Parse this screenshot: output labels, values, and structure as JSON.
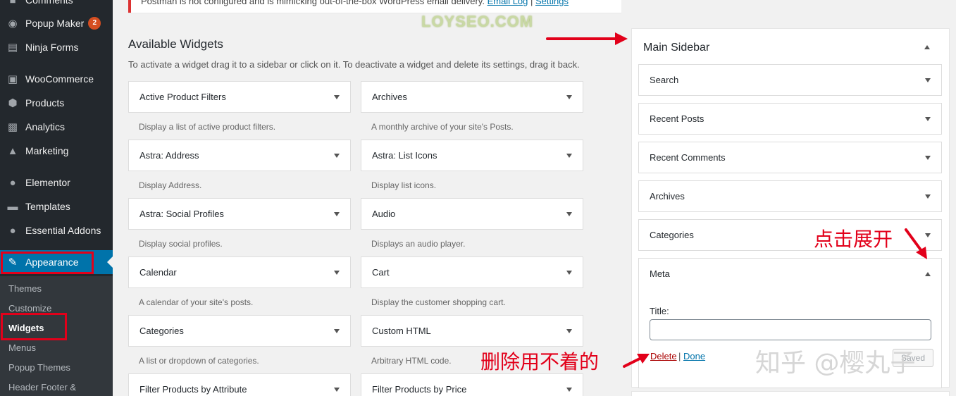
{
  "notice": {
    "text": "Postman is not configured and is mimicking out-of-the-box WordPress email delivery.",
    "link_log": "Email Log",
    "link_settings": "Settings"
  },
  "watermark_top": "LOYSEO.COM",
  "menu": {
    "comments": "Comments",
    "popup_maker": "Popup Maker",
    "popup_maker_badge": "2",
    "ninja_forms": "Ninja Forms",
    "woocommerce": "WooCommerce",
    "products": "Products",
    "analytics": "Analytics",
    "marketing": "Marketing",
    "elementor": "Elementor",
    "templates": "Templates",
    "essential_addons": "Essential Addons",
    "appearance": "Appearance"
  },
  "submenu": {
    "themes": "Themes",
    "customize": "Customize",
    "widgets": "Widgets",
    "menus": "Menus",
    "popup_themes": "Popup Themes",
    "header_footer": "Header Footer &"
  },
  "available": {
    "title": "Available Widgets",
    "description": "To activate a widget drag it to a sidebar or click on it. To deactivate a widget and delete its settings, drag it back.",
    "widgets": [
      {
        "title": "Active Product Filters",
        "desc": "Display a list of active product filters."
      },
      {
        "title": "Archives",
        "desc": "A monthly archive of your site's Posts."
      },
      {
        "title": "Astra: Address",
        "desc": "Display Address."
      },
      {
        "title": "Astra: List Icons",
        "desc": "Display list icons."
      },
      {
        "title": "Astra: Social Profiles",
        "desc": "Display social profiles."
      },
      {
        "title": "Audio",
        "desc": "Displays an audio player."
      },
      {
        "title": "Calendar",
        "desc": "A calendar of your site's posts."
      },
      {
        "title": "Cart",
        "desc": "Display the customer shopping cart."
      },
      {
        "title": "Categories",
        "desc": "A list or dropdown of categories."
      },
      {
        "title": "Custom HTML",
        "desc": "Arbitrary HTML code."
      },
      {
        "title": "Filter Products by Attribute",
        "desc": ""
      },
      {
        "title": "Filter Products by Price",
        "desc": ""
      }
    ]
  },
  "sidebar": {
    "title": "Main Sidebar",
    "widgets": [
      "Search",
      "Recent Posts",
      "Recent Comments",
      "Archives",
      "Categories",
      "Meta"
    ],
    "meta_form": {
      "title_label": "Title:",
      "title_value": "",
      "delete_label": "Delete",
      "separator": "|",
      "done_label": "Done",
      "save_label": "Saved"
    }
  },
  "annotations": {
    "expand": "点击展开",
    "delete_unused": "删除用不着的",
    "watermark": "知乎 @樱丸子"
  },
  "colors": {
    "menu_bg": "#23282d",
    "submenu_bg": "#32373c",
    "current_menu": "#0073aa",
    "annotation_red": "#e2001a",
    "link_blue": "#0073aa",
    "delete_red": "#aa0000"
  }
}
